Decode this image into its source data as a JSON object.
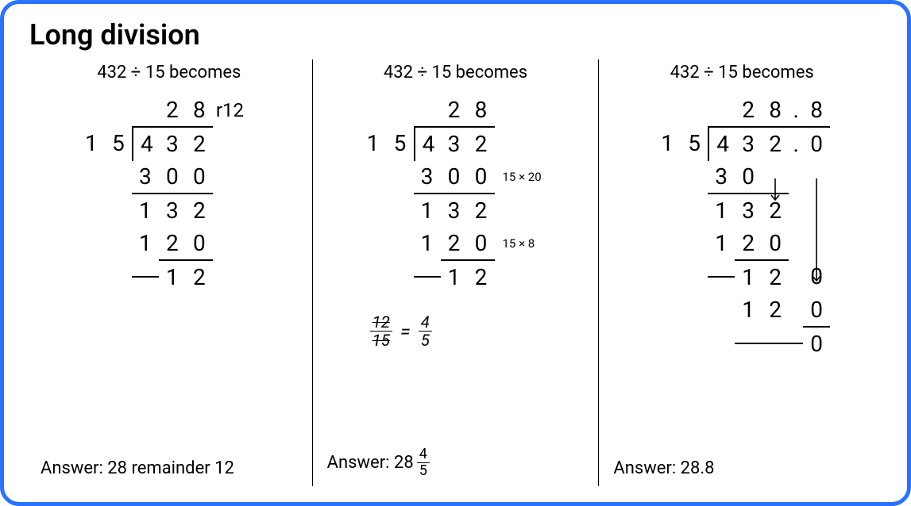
{
  "title": "Long division",
  "dividend": "432",
  "divisor": "15",
  "problem_text": "432 ÷ 15 becomes",
  "remainder_label": "r12",
  "col1": {
    "quotient": [
      "2",
      "8"
    ],
    "divisor_digits": [
      "1",
      "5"
    ],
    "dividend_digits": [
      "4",
      "3",
      "2"
    ],
    "step1": [
      "3",
      "0",
      "0"
    ],
    "diff1": [
      "1",
      "3",
      "2"
    ],
    "step2": [
      "1",
      "2",
      "0"
    ],
    "final": [
      "1",
      "2"
    ],
    "answer": "Answer: 28 remainder 12"
  },
  "col2": {
    "quotient": [
      "2",
      "8"
    ],
    "divisor_digits": [
      "1",
      "5"
    ],
    "dividend_digits": [
      "4",
      "3",
      "2"
    ],
    "step1": [
      "3",
      "0",
      "0"
    ],
    "side1": "15 × 20",
    "diff1": [
      "1",
      "3",
      "2"
    ],
    "step2": [
      "1",
      "2",
      "0"
    ],
    "side2": "15 × 8",
    "final": [
      "1",
      "2"
    ],
    "frac_before": {
      "num": "12",
      "den": "15"
    },
    "frac_after": {
      "num": "4",
      "den": "5"
    },
    "answer_prefix": "Answer: 28",
    "answer_frac": {
      "num": "4",
      "den": "5"
    }
  },
  "col3": {
    "quotient": [
      "2",
      "8",
      ".",
      "8"
    ],
    "divisor_digits": [
      "1",
      "5"
    ],
    "dividend_digits": [
      "4",
      "3",
      "2",
      ".",
      "0"
    ],
    "step1": [
      "3",
      "0"
    ],
    "diff1": [
      "1",
      "3",
      "2"
    ],
    "step2": [
      "1",
      "2",
      "0"
    ],
    "diff2": [
      "1",
      "2",
      "0"
    ],
    "step3": [
      "1",
      "2",
      "0"
    ],
    "final": [
      "0"
    ],
    "answer": "Answer: 28.8"
  }
}
